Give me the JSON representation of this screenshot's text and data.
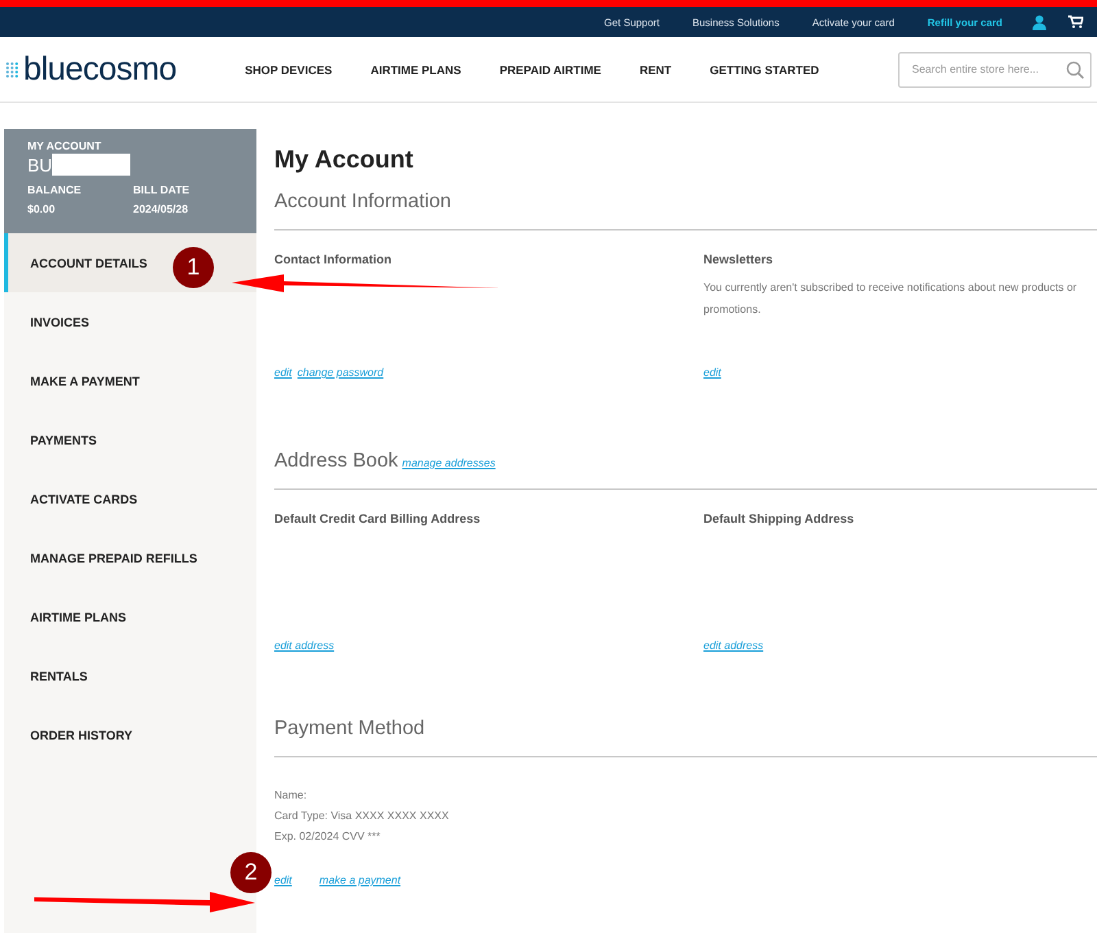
{
  "top_bar": {
    "links": [
      {
        "label": "Get Support",
        "highlight": false
      },
      {
        "label": "Business Solutions",
        "highlight": false
      },
      {
        "label": "Activate your card",
        "highlight": false
      },
      {
        "label": "Refill your card",
        "highlight": true
      }
    ]
  },
  "header": {
    "logo": "bluecosmo",
    "nav": [
      "SHOP DEVICES",
      "AIRTIME PLANS",
      "PREPAID AIRTIME",
      "RENT",
      "GETTING STARTED"
    ],
    "search": {
      "placeholder": "Search entire store here..."
    }
  },
  "account_card": {
    "label": "MY ACCOUNT",
    "name": "BU",
    "balance_label": "BALANCE",
    "balance": "$0.00",
    "bill_date_label": "BILL DATE",
    "bill_date": "2024/05/28"
  },
  "sidebar": {
    "items": [
      {
        "label": "ACCOUNT DETAILS",
        "selected": true
      },
      {
        "label": "INVOICES",
        "selected": false
      },
      {
        "label": "MAKE A PAYMENT",
        "selected": false
      },
      {
        "label": "PAYMENTS",
        "selected": false
      },
      {
        "label": "ACTIVATE CARDS",
        "selected": false
      },
      {
        "label": "MANAGE PREPAID REFILLS",
        "selected": false
      },
      {
        "label": "AIRTIME PLANS",
        "selected": false
      },
      {
        "label": "RENTALS",
        "selected": false
      },
      {
        "label": "ORDER HISTORY",
        "selected": false
      }
    ]
  },
  "page_title": "My Account",
  "account_information": {
    "title": "Account Information",
    "columns": [
      {
        "heading": "Contact Information",
        "links": [
          "edit",
          "change password"
        ]
      },
      {
        "heading": "Newsletters",
        "lines": [
          "You currently aren't subscribed to receive notifications about new products or promotions."
        ],
        "links": [
          "edit"
        ]
      }
    ]
  },
  "address_book": {
    "title": "Address Book",
    "link": "manage addresses",
    "columns": [
      {
        "heading": "Default Credit Card Billing Address",
        "links": [
          "edit address"
        ]
      },
      {
        "heading": "Default Shipping Address",
        "links": [
          "edit address"
        ]
      }
    ]
  },
  "payment_method": {
    "title": "Payment Method",
    "lines": [
      "Name:",
      "Card Type: Visa XXXX XXXX XXXX",
      "Exp. 02/2024 CVV ***"
    ],
    "links": [
      "edit",
      "make a payment"
    ]
  },
  "annotations": [
    {
      "number": "1"
    },
    {
      "number": "2"
    }
  ]
}
